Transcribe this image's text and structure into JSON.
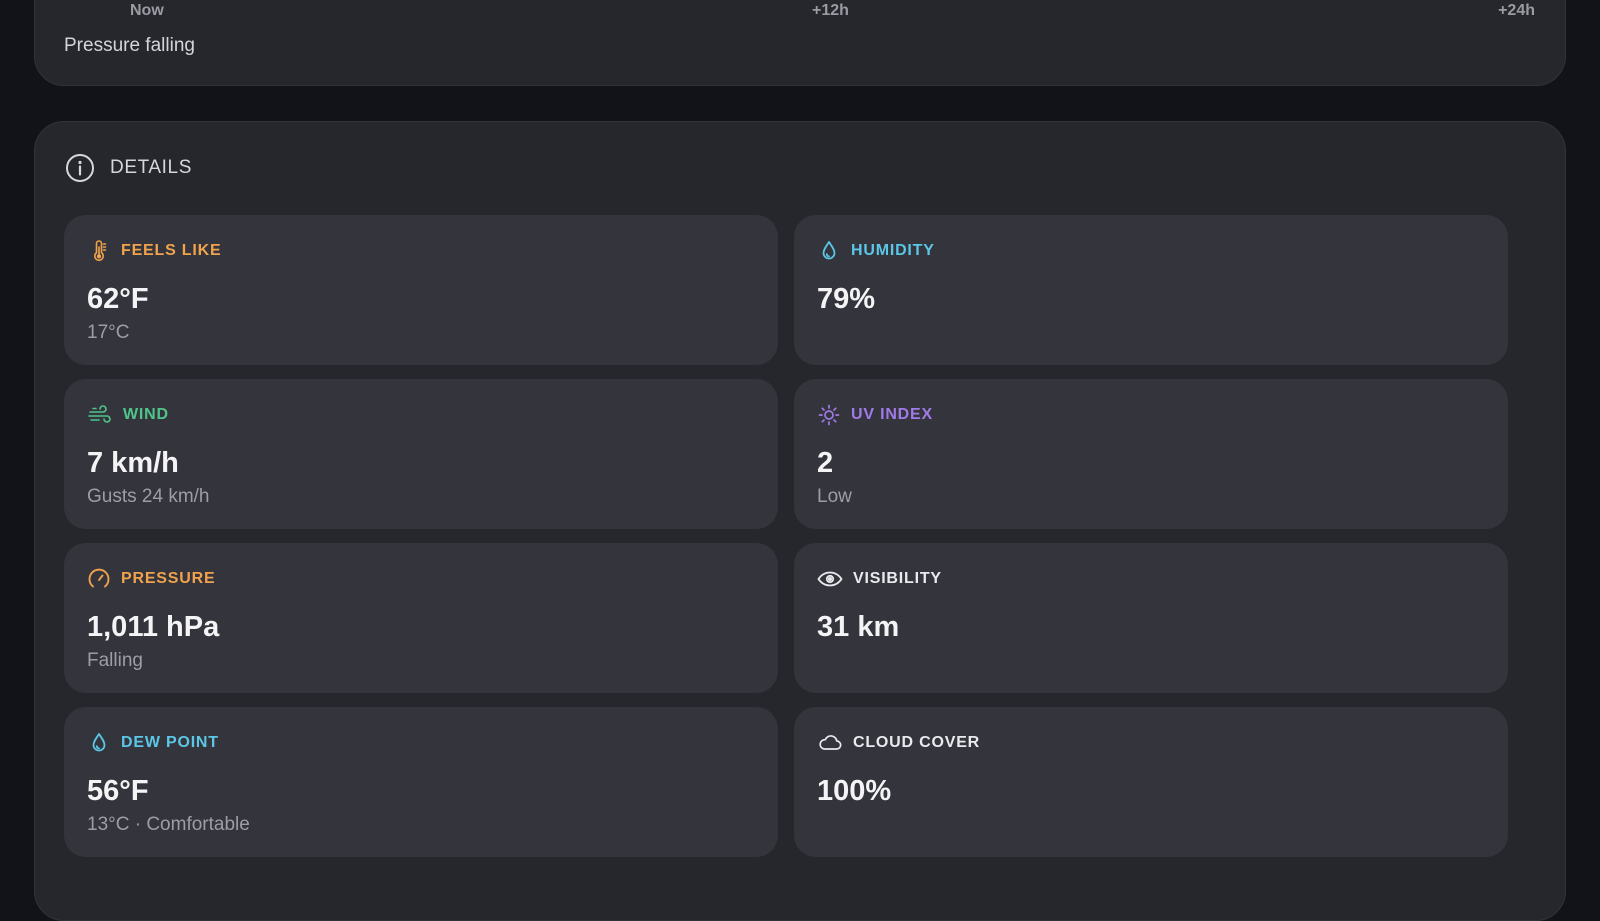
{
  "pressure_chart": {
    "ticks": [
      "Now",
      "+12h",
      "+24h"
    ],
    "trend_text": "Pressure falling"
  },
  "details": {
    "title": "DETAILS",
    "icon": "info-icon",
    "cards": [
      {
        "label": "FEELS LIKE",
        "value": "62°F",
        "sub": "17°C",
        "icon": "thermometer-icon",
        "color": "#f0a24c"
      },
      {
        "label": "HUMIDITY",
        "value": "79%",
        "sub": "",
        "icon": "droplet-icon",
        "color": "#5cc6e6"
      },
      {
        "label": "WIND",
        "value": "7 km/h",
        "sub": "Gusts 24 km/h",
        "icon": "wind-icon",
        "color": "#4fc58a"
      },
      {
        "label": "UV INDEX",
        "value": "2",
        "sub": "Low",
        "icon": "sun-icon",
        "color": "#a07ae8"
      },
      {
        "label": "PRESSURE",
        "value": "1,011 hPa",
        "sub": "Falling",
        "icon": "gauge-icon",
        "color": "#f0a24c"
      },
      {
        "label": "VISIBILITY",
        "value": "31 km",
        "sub": "",
        "icon": "eye-icon",
        "color": "#e9eaee"
      },
      {
        "label": "DEW POINT",
        "value": "56°F",
        "sub": "13°C · Comfortable",
        "icon": "droplet-icon",
        "color": "#5cc6e6"
      },
      {
        "label": "CLOUD COVER",
        "value": "100%",
        "sub": "",
        "icon": "cloud-icon",
        "color": "#e9eaee"
      }
    ]
  }
}
